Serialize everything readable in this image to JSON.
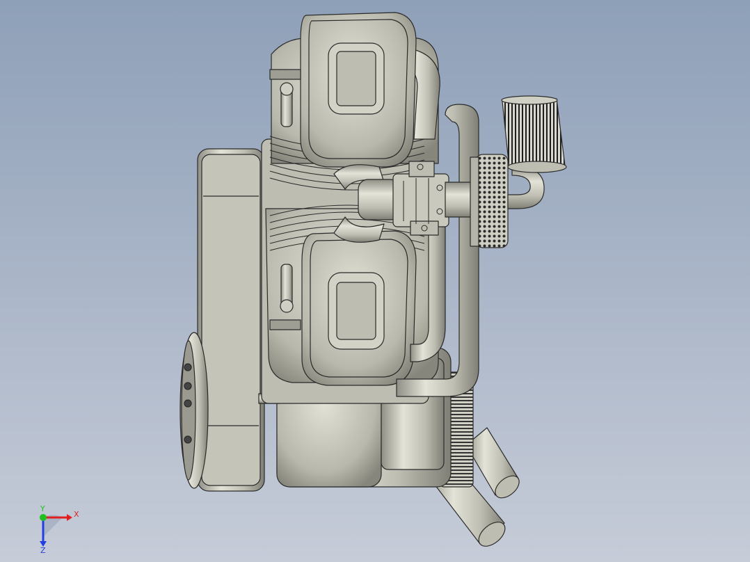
{
  "viewport": {
    "background_top": "#8ea0b8",
    "background_bottom": "#c6ccd8",
    "model": "twin-cylinder-engine",
    "model_color": "#c9c9bd",
    "edge_color": "#2a2a2a"
  },
  "triad": {
    "x_label": "X",
    "y_label": "Y",
    "z_label": "Z",
    "x_color": "#e02020",
    "y_color": "#20c020",
    "z_color": "#2040e0"
  }
}
